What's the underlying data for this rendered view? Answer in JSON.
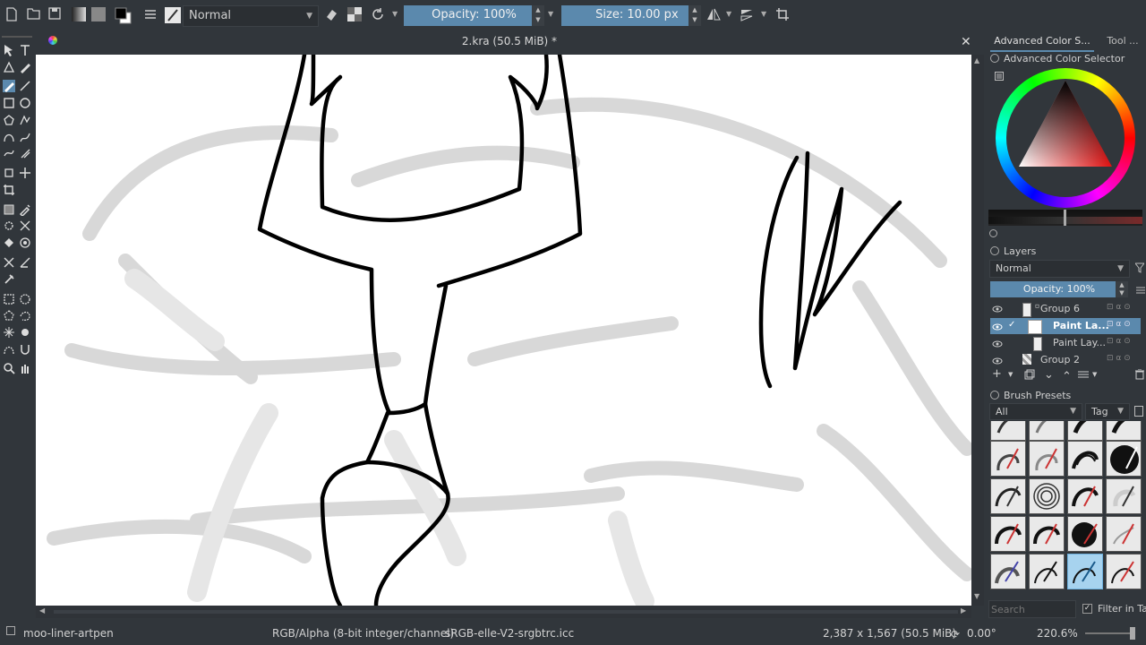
{
  "toolbar": {
    "blend_mode": "Normal",
    "opacity_label": "Opacity: 100%",
    "size_label": "Size: 10.00 px"
  },
  "document": {
    "title": "2.kra (50.5 MiB) *"
  },
  "dockers": {
    "tabs": [
      "Advanced Color S...",
      "Tool ..."
    ],
    "color_selector_title": "Advanced Color Selector",
    "layers_title": "Layers",
    "layers_blend_mode": "Normal",
    "layers_opacity": "Opacity:  100%",
    "layers": [
      {
        "name": "Group 6",
        "type": "group",
        "selected": false
      },
      {
        "name": "Paint La...",
        "type": "paint",
        "selected": true
      },
      {
        "name": "Paint Lay...",
        "type": "paint",
        "selected": false
      },
      {
        "name": "Group 2",
        "type": "group",
        "selected": false
      }
    ],
    "brush_presets_title": "Brush Presets",
    "brush_filter": "All",
    "tag_label": "Tag",
    "search_placeholder": "Search",
    "filter_in_tag": "Filter in Tag"
  },
  "status": {
    "brush_name": "moo-liner-artpen",
    "color_model": "RGB/Alpha (8-bit integer/channel)",
    "profile": "sRGB-elle-V2-srgbtrc.icc",
    "image_size": "2,387 x 1,567 (50.5 MiB)",
    "rotation": "0.00°",
    "zoom": "220.6%"
  },
  "colors": {
    "accent": "#5b89ad",
    "selection": "#a7d3ef",
    "background": "#31363b"
  }
}
